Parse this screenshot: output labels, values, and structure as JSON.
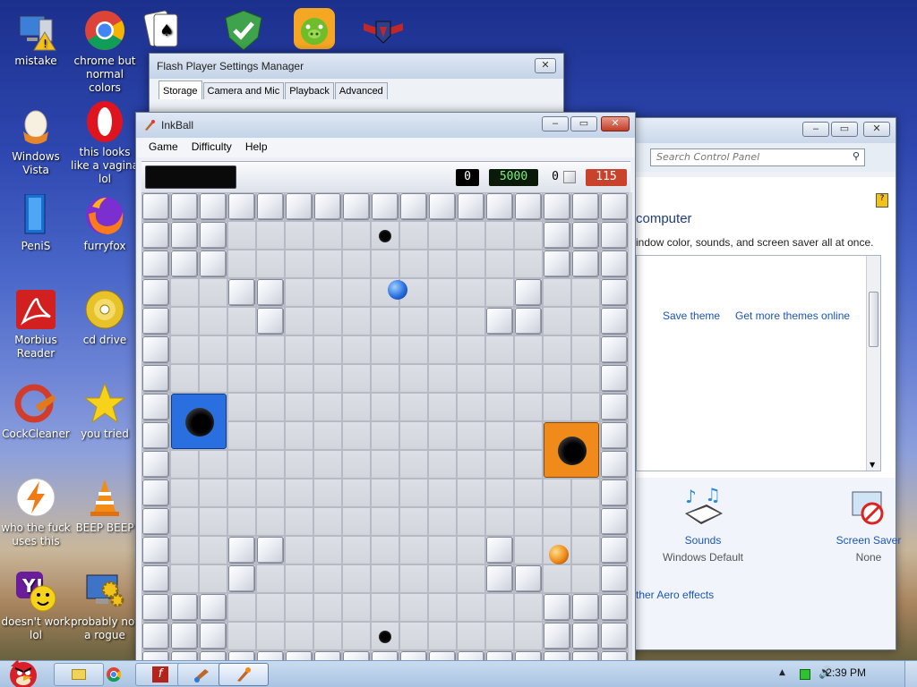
{
  "desktop_icons": [
    {
      "label": "mistake",
      "icon": "monitor-warning-icon"
    },
    {
      "label": "chrome but normal colors",
      "icon": "chrome-icon"
    },
    {
      "label": "",
      "icon": "solitaire-cards-icon"
    },
    {
      "label": "",
      "icon": "security-shield-icon"
    },
    {
      "label": "",
      "icon": "bad-piggies-icon"
    },
    {
      "label": "",
      "icon": "winged-shield-icon"
    },
    {
      "label": "Windows Vista",
      "icon": "egg-icon"
    },
    {
      "label": "this looks like a vagina lol",
      "icon": "opera-icon"
    },
    {
      "label": "PeniS",
      "icon": "blue-slab-icon"
    },
    {
      "label": "furryfox",
      "icon": "firefox-icon"
    },
    {
      "label": "Morbius Reader",
      "icon": "adobe-reader-icon"
    },
    {
      "label": "cd drive",
      "icon": "cd-drive-icon"
    },
    {
      "label": "CockCleaner",
      "icon": "ccleaner-icon"
    },
    {
      "label": "you tried",
      "icon": "gold-star-icon"
    },
    {
      "label": "who the fuck uses this",
      "icon": "winamp-bolt-icon"
    },
    {
      "label": "BEEP BEEP",
      "icon": "vlc-cone-icon"
    },
    {
      "label": "doesn't work lol",
      "icon": "yahoo-messenger-icon"
    },
    {
      "label": "probably not a rogue",
      "icon": "gear-monitor-icon"
    }
  ],
  "flash_window": {
    "title": "Flash Player Settings Manager",
    "tabs": [
      "Storage",
      "Camera and Mic",
      "Playback",
      "Advanced"
    ],
    "active_tab": "Storage"
  },
  "control_panel": {
    "search_placeholder": "Search Control Panel",
    "heading": "computer",
    "subtext": "indow color, sounds, and screen saver all at once.",
    "save_theme": "Save theme",
    "more_themes": "Get more themes online",
    "items": [
      {
        "label": "Sounds",
        "value": "Windows Default",
        "icon": "sounds-piano-icon"
      },
      {
        "label": "Screen Saver",
        "value": "None",
        "icon": "screen-saver-none-icon"
      }
    ],
    "aero_link": "ther Aero effects"
  },
  "inkball": {
    "title": "InkBall",
    "menu": [
      "Game",
      "Difficulty",
      "Help"
    ],
    "score": "0",
    "time": "5000",
    "balls_left": "0",
    "red_counter": "115",
    "colors": {
      "blue": "#2a6fe0",
      "orange": "#f08a1a",
      "red_counter": "#c9422c",
      "time_green": "#7cf07c"
    }
  },
  "taskbar": {
    "clock": "2:39 PM",
    "buttons": [
      "folder-icon",
      "chrome-taskbar-icon",
      "flash-taskbar-icon",
      "paint-taskbar-icon",
      "inkball-taskbar-icon"
    ]
  }
}
